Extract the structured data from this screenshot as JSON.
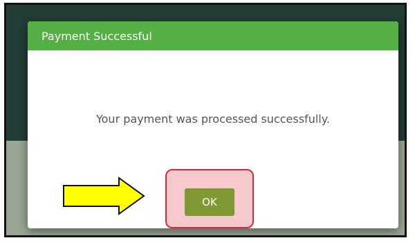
{
  "dialog": {
    "title": "Payment Successful",
    "message": "Your payment was processed successfully.",
    "ok_label": "OK"
  },
  "colors": {
    "header": "#55b044",
    "ok_button": "#7f9a35",
    "highlight_border": "#e0243d",
    "arrow_fill": "#ffff00",
    "backdrop_dark": "#213d35"
  },
  "annotations": {
    "arrow_icon": "right-arrow-icon"
  }
}
